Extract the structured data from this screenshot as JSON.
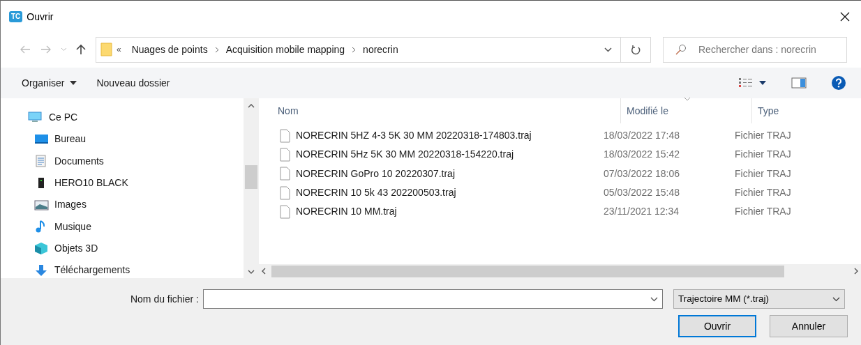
{
  "window": {
    "title": "Ouvrir",
    "app_badge": "TC"
  },
  "address": {
    "prefix": "«",
    "path": [
      "Nuages de points",
      "Acquisition mobile mapping",
      "norecrin"
    ]
  },
  "search": {
    "placeholder": "Rechercher dans : norecrin"
  },
  "toolbar": [
    {
      "label": "Organiser",
      "has_menu": true
    },
    {
      "label": "Nouveau dossier",
      "has_menu": false
    }
  ],
  "sidebar": {
    "items": [
      {
        "label": "Ce PC",
        "kind": "pc",
        "children": [
          {
            "label": "Bureau",
            "kind": "desktop"
          },
          {
            "label": "Documents",
            "kind": "documents"
          },
          {
            "label": "HERO10 BLACK",
            "kind": "device"
          },
          {
            "label": "Images",
            "kind": "images"
          },
          {
            "label": "Musique",
            "kind": "music"
          },
          {
            "label": "Objets 3D",
            "kind": "objects3d"
          },
          {
            "label": "Téléchargements",
            "kind": "downloads"
          }
        ]
      }
    ]
  },
  "table": {
    "columns": [
      {
        "label": "Nom",
        "sorted": false
      },
      {
        "label": "Modifié le",
        "sorted": true
      },
      {
        "label": "Type",
        "sorted": false
      }
    ],
    "rows": [
      {
        "name": "NORECRIN 5HZ 4-3 5K 30 MM 20220318-174803.traj",
        "modified": "18/03/2022 17:48",
        "type": "Fichier TRAJ"
      },
      {
        "name": "NORECRIN 5Hz 5K 30 MM 20220318-154220.traj",
        "modified": "18/03/2022 15:42",
        "type": "Fichier TRAJ"
      },
      {
        "name": "NORECRIN GoPro 10 20220307.traj",
        "modified": "07/03/2022 18:06",
        "type": "Fichier TRAJ"
      },
      {
        "name": "NORECRIN 10 5k 43 202200503.traj",
        "modified": "05/03/2022 15:48",
        "type": "Fichier TRAJ"
      },
      {
        "name": "NORECRIN 10 MM.traj",
        "modified": "23/11/2021 12:34",
        "type": "Fichier TRAJ"
      }
    ]
  },
  "filename": {
    "label": "Nom du fichier :"
  },
  "filter": {
    "value": "Trajectoire MM (*.traj)"
  },
  "buttons": [
    {
      "label": "Ouvrir",
      "default": true
    },
    {
      "label": "Annuler",
      "default": false
    }
  ]
}
